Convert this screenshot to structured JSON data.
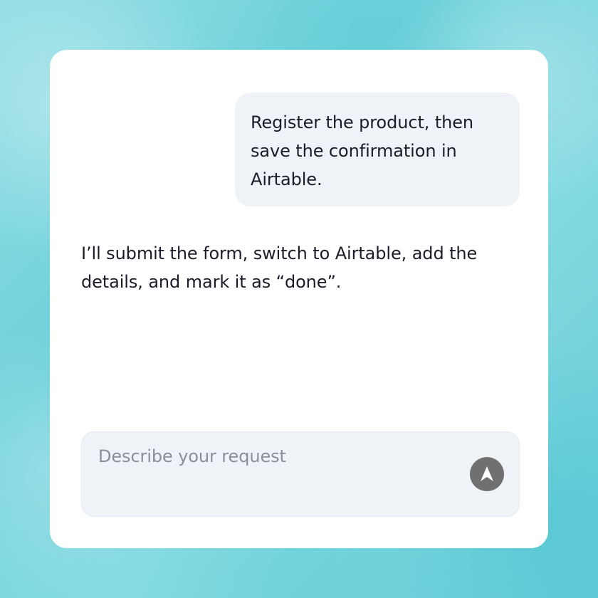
{
  "chat": {
    "user_message": "Register the product, then save the confirmation in Airtable.",
    "assistant_message": "I’ll submit the form, switch to Airtable, add the details, and mark it as “done”."
  },
  "composer": {
    "placeholder": "Describe your request",
    "send_icon": "arrow-up-icon"
  },
  "colors": {
    "background": "#6fd1db",
    "card": "#ffffff",
    "bubble": "#eff2f7",
    "send_button": "#707070",
    "text": "#1a1d29",
    "placeholder": "#8c8f96"
  }
}
